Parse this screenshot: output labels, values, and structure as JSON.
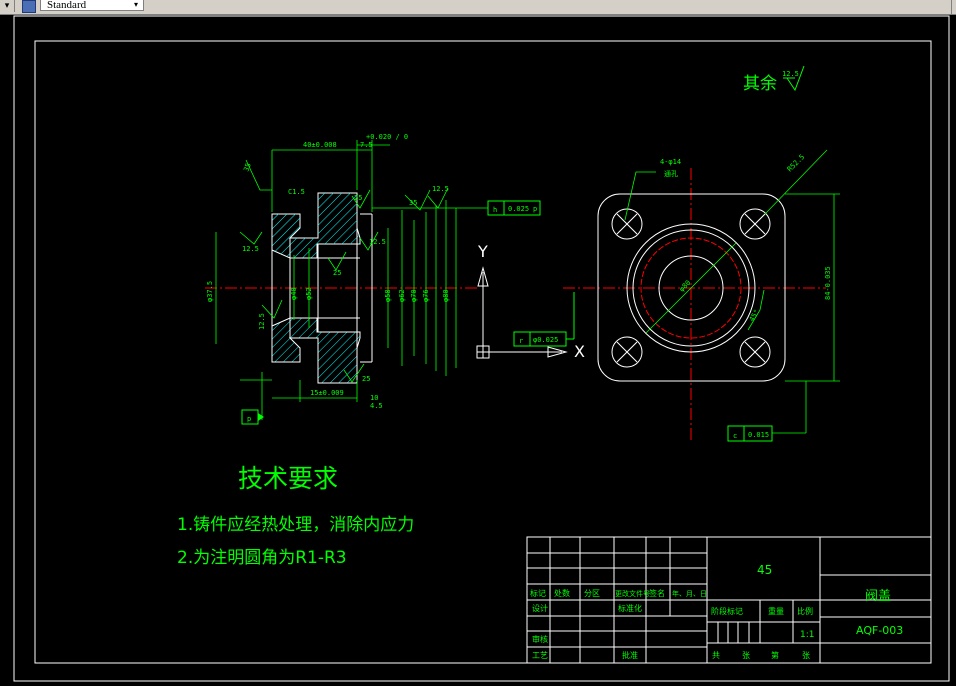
{
  "toolbar": {
    "style_combo_value": "Standard",
    "accent_color": "#d4d0c8"
  },
  "drawing": {
    "line_color": "#ffffff",
    "annotation_color": "#00ff00",
    "centerline_color": "#ff0000",
    "hatch_color": "#00ffff",
    "surface_finish_note": {
      "label": "其余",
      "value": "12.5"
    },
    "axis_labels": {
      "x": "X",
      "y": "Y"
    },
    "left_view": {
      "dims": {
        "top_1": "40±0.008",
        "top_2": "7.5",
        "top_tol": "+0.020 / 0",
        "chamfer": "C1.5",
        "radius": "35",
        "angle": "35",
        "finish_1": "12.5",
        "finish_2": "12.5",
        "finish_3": "12.5",
        "finish_4": "25",
        "finish_5": "25",
        "finish_6": "25",
        "finish_7": "12.5",
        "dia_1": "φ40",
        "dia_2": "φ52",
        "dia_3": "φ58",
        "dia_4": "φ62",
        "dia_5": "φ70",
        "dia_6": "φ76",
        "dia_7": "φ80",
        "dia_left": "φ37.5",
        "bottom_1": "15±0.009",
        "bottom_2": "10",
        "bottom_3": "4.5"
      },
      "tolerance_frame_h": {
        "symbol": "h",
        "value": "0.025",
        "datum": "p"
      },
      "datum_p": "p"
    },
    "right_view": {
      "hole_note": {
        "line1": "4-φ14",
        "line2": "通孔"
      },
      "radius_note": "R52.5",
      "dia_center": "φ80",
      "angle": "45°",
      "side_dim": "84-0.035",
      "tolerance_frame_r": {
        "symbol": "r",
        "value": "φ0.025"
      },
      "tolerance_frame_c": {
        "symbol": "c",
        "value": "0.015"
      }
    },
    "technical_requirements": {
      "title": "技术要求",
      "item1": "1.铸件应经热处理，消除内应力",
      "item2": "2.为注明圆角为R1-R3"
    },
    "title_block": {
      "material": "45",
      "part_name": "阀盖",
      "drawing_number": "AQF-003",
      "scale": "1:1",
      "row_labels": {
        "biaoji": "标记",
        "chushu": "处数",
        "fenqu": "分区",
        "gengai": "更改文件号",
        "qianming": "签名",
        "nianyueri": "年、月、日",
        "sheji": "设计",
        "biaozhunhua": "标准化",
        "shenhe": "审核",
        "gongyi": "工艺",
        "pizhun": "批准",
        "jieduan": "阶段标记",
        "zhongliang": "重量",
        "bili": "比例",
        "gong": "共",
        "zhang": "张",
        "di": "第",
        "zhang2": "张"
      }
    }
  }
}
